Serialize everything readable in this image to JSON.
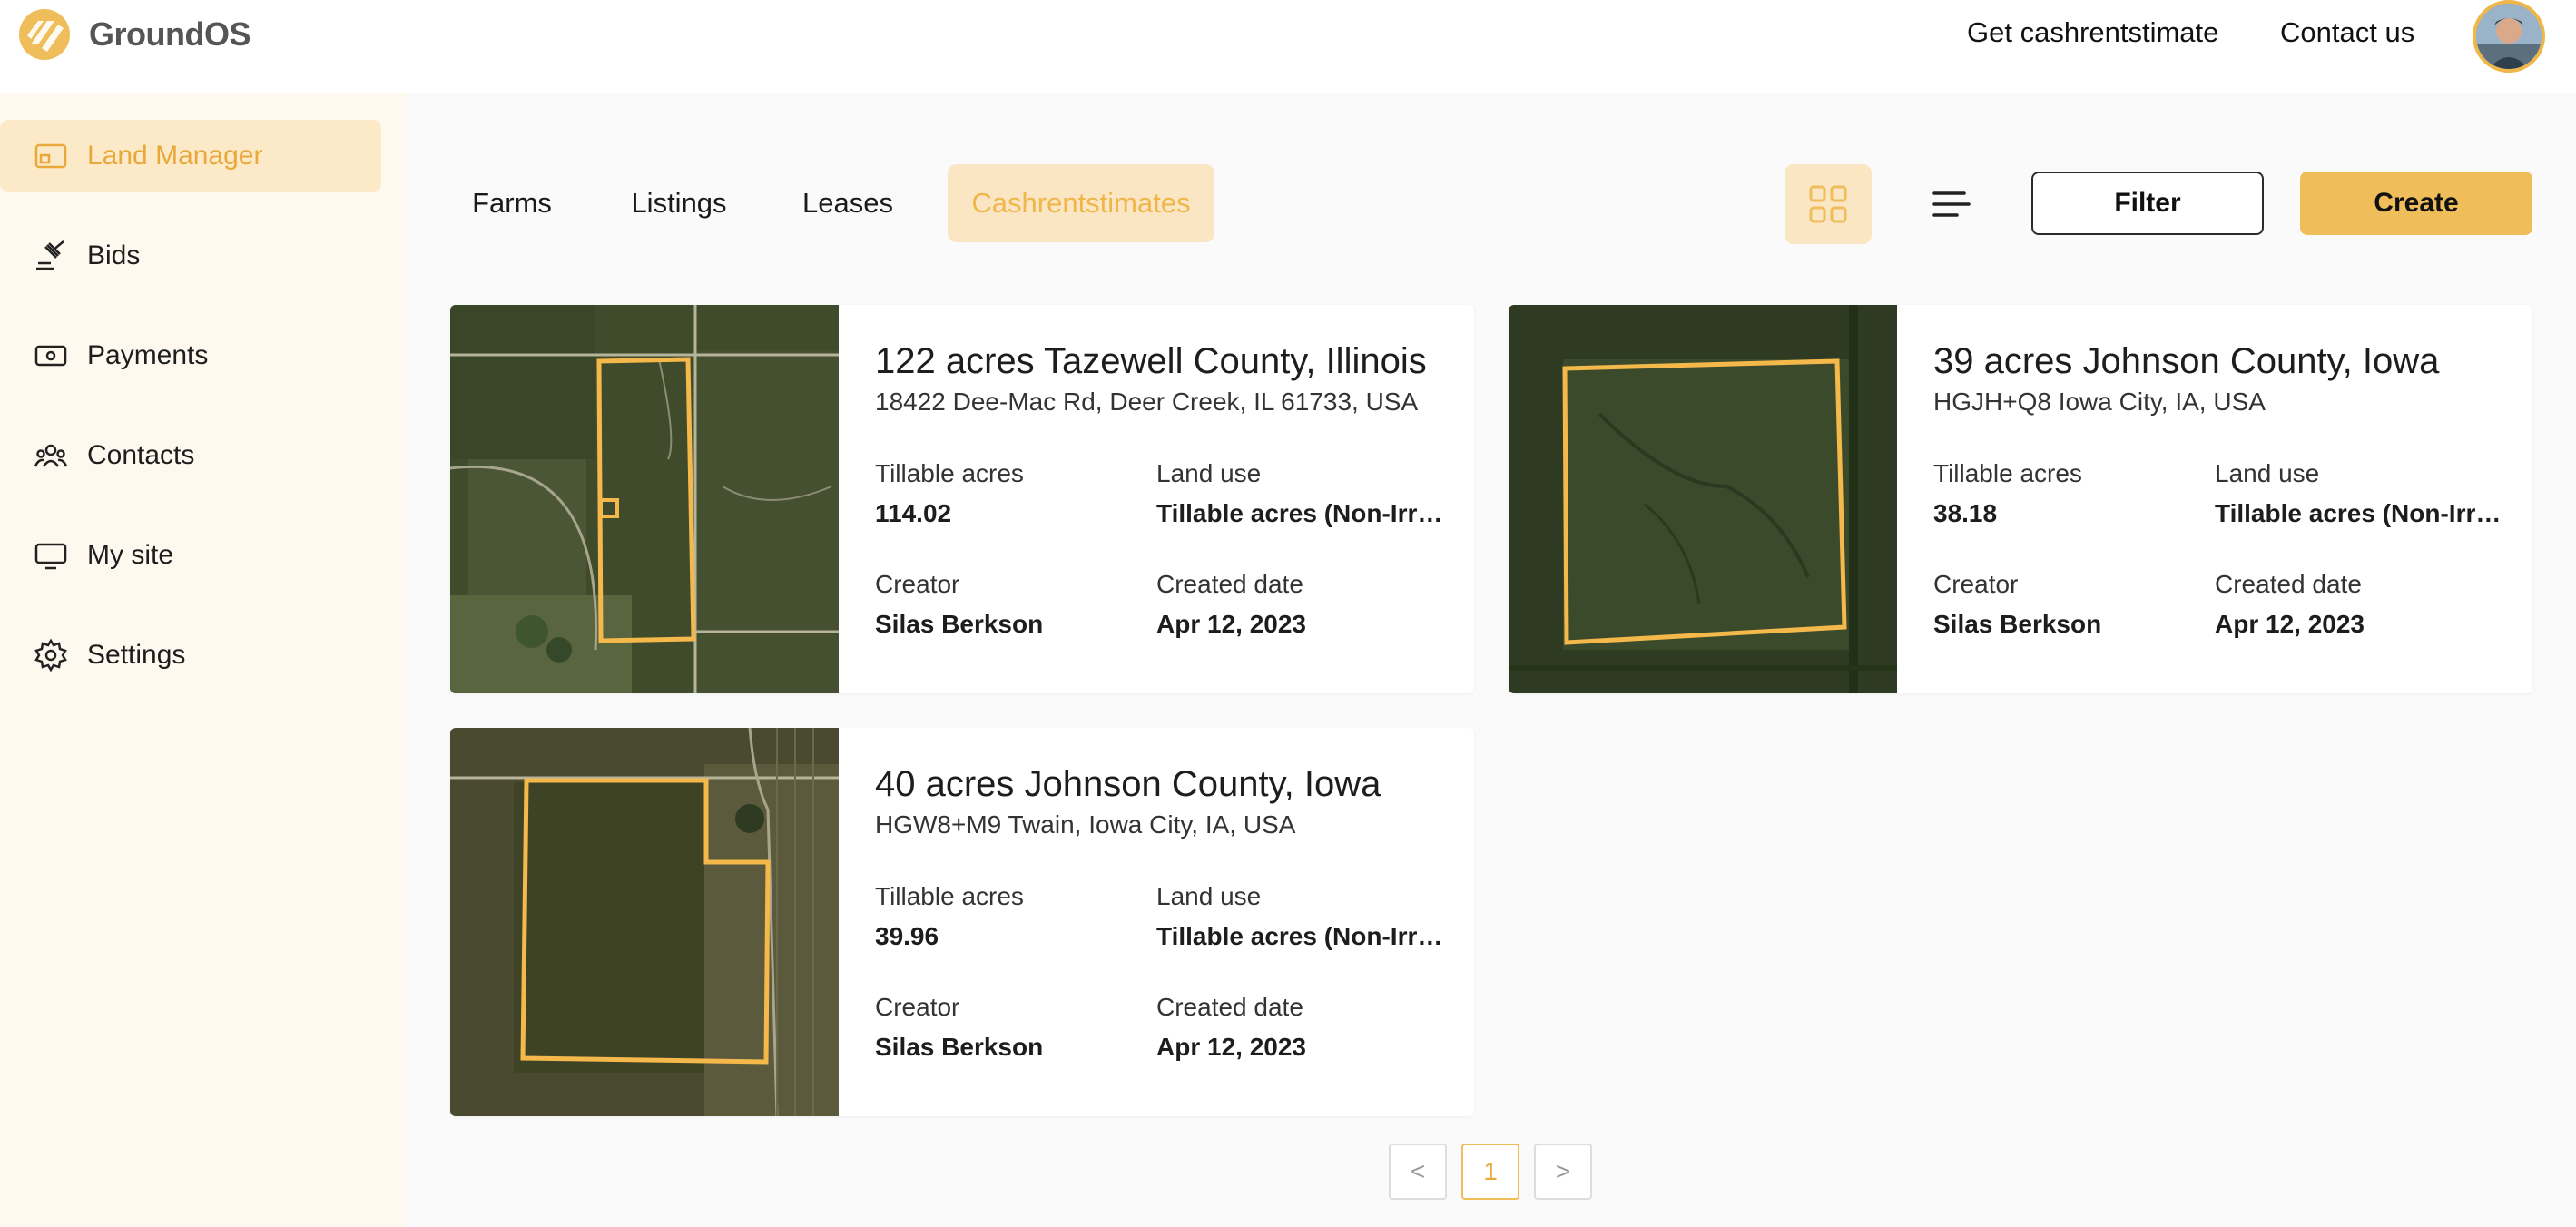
{
  "header": {
    "brand": "GroundOS",
    "links": [
      {
        "label": "Get cashrentstimate"
      },
      {
        "label": "Contact us"
      }
    ]
  },
  "sidebar": {
    "items": [
      {
        "label": "Land Manager",
        "icon": "land-icon",
        "active": true
      },
      {
        "label": "Bids",
        "icon": "gavel-icon"
      },
      {
        "label": "Payments",
        "icon": "money-icon"
      },
      {
        "label": "Contacts",
        "icon": "people-icon"
      },
      {
        "label": "My site",
        "icon": "monitor-icon"
      },
      {
        "label": "Settings",
        "icon": "gear-icon"
      }
    ]
  },
  "tabs": [
    {
      "label": "Farms"
    },
    {
      "label": "Listings"
    },
    {
      "label": "Leases"
    },
    {
      "label": "Cashrentstimates",
      "active": true
    }
  ],
  "toolbar": {
    "filter_label": "Filter",
    "create_label": "Create"
  },
  "field_labels": {
    "tillable": "Tillable acres",
    "land_use": "Land use",
    "creator": "Creator",
    "created": "Created date"
  },
  "cards": [
    {
      "title": "122 acres Tazewell County, Illinois",
      "address": "18422 Dee-Mac Rd, Deer Creek, IL 61733, USA",
      "tillable": "114.02",
      "land_use": "Tillable acres (Non-Irrigated)",
      "creator": "Silas Berkson",
      "created": "Apr 12, 2023"
    },
    {
      "title": "39 acres Johnson County, Iowa",
      "address": "HGJH+Q8 Iowa City, IA, USA",
      "tillable": "38.18",
      "land_use": "Tillable acres (Non-Irrigated)",
      "creator": "Silas Berkson",
      "created": "Apr 12, 2023"
    },
    {
      "title": "40 acres Johnson County, Iowa",
      "address": "HGW8+M9 Twain, Iowa City, IA, USA",
      "tillable": "39.96",
      "land_use": "Tillable acres (Non-Irrigated)",
      "creator": "Silas Berkson",
      "created": "Apr 12, 2023"
    }
  ],
  "pagination": {
    "prev": "<",
    "current": "1",
    "next": ">"
  },
  "colors": {
    "accent": "#efbd5a",
    "accent_light": "#fae6c3",
    "sidebar_bg": "#fff8ee"
  }
}
